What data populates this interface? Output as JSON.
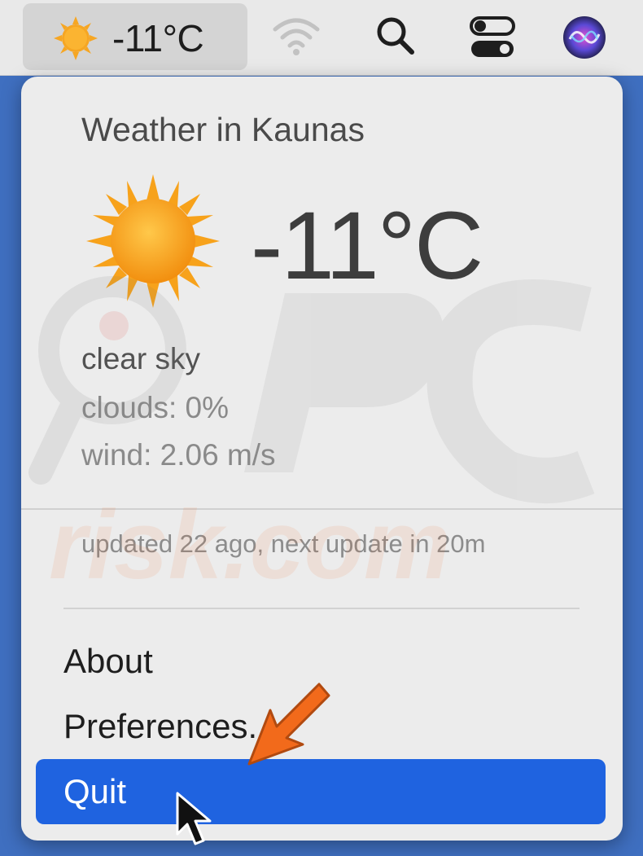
{
  "menubar": {
    "weather_temp": "-11°C",
    "icons": [
      "sun-icon",
      "wifi-icon",
      "search-icon",
      "control-center-icon",
      "siri-icon"
    ]
  },
  "menu": {
    "title": "Weather in Kaunas",
    "temperature": "-11°C",
    "description": "clear sky",
    "clouds": "clouds: 0%",
    "wind": "wind: 2.06 m/s",
    "updated": "updated 22 ago, next update in 20m",
    "items": {
      "about": "About",
      "preferences": "Preferences...",
      "quit": "Quit"
    }
  },
  "colors": {
    "accent": "#1f63e0",
    "menu_bg": "#ececec",
    "desktop": "#3f6fc0",
    "sun": "#f7a21b",
    "arrow": "#f26a1b"
  },
  "watermark": "PC risk.com"
}
